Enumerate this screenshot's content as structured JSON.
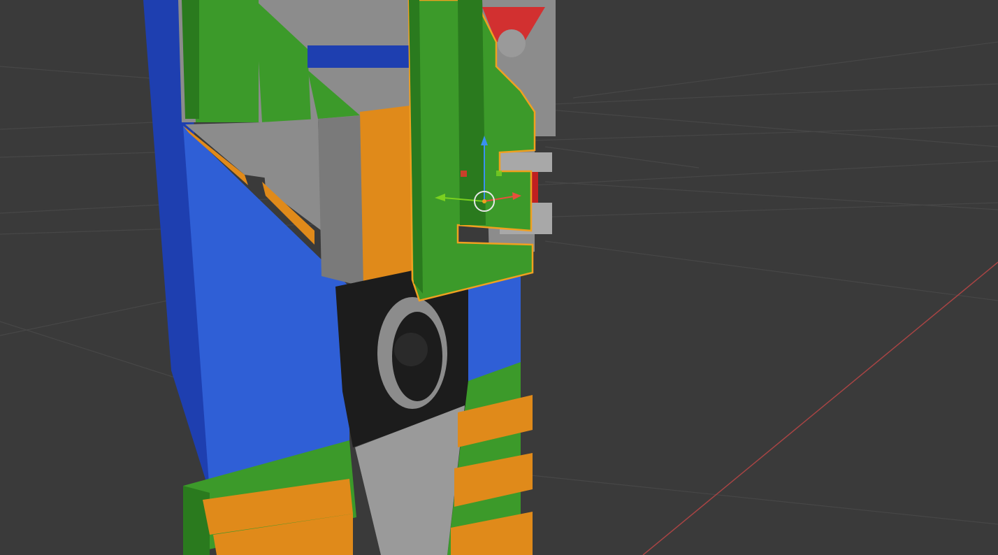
{
  "viewport": {
    "background": "#3a3a3a",
    "grid_color": "#4a4a4a",
    "x_axis_color": "#b84a4a"
  },
  "model": {
    "colors": {
      "blue": "#2f5fd6",
      "blue_dark": "#1e3fb0",
      "green": "#3c9a2a",
      "green_dark": "#2a7a1e",
      "orange": "#e08a1a",
      "orange_dark": "#b86a0e",
      "gray": "#8c8c8c",
      "gray_light": "#a8a8a8",
      "gray_dark": "#5a5a5a",
      "black": "#1c1c1c",
      "red": "#d23030"
    },
    "selected_outline": "#f0a020"
  },
  "gizmo": {
    "x_color": "#e8503c",
    "y_color": "#7ad020",
    "z_color": "#3a90f0",
    "center_ring": "#e8e8e8",
    "pivot_dot": "#f0a020"
  }
}
